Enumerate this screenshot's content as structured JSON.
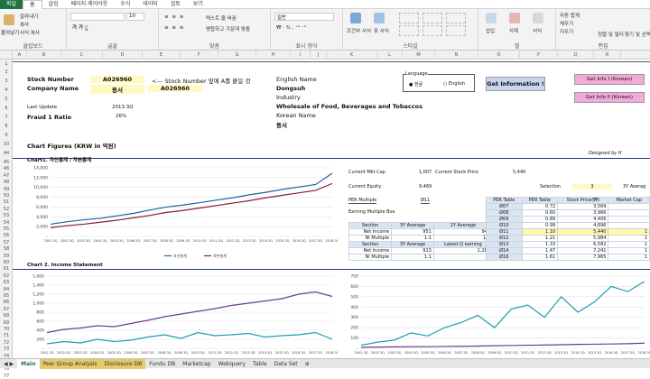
{
  "ribbon_tabs": [
    "파일",
    "홈",
    "삽입",
    "페이지 레이아웃",
    "수식",
    "데이터",
    "검토",
    "보기"
  ],
  "ribbon": {
    "clipboard": {
      "label": "클립보드",
      "paste": "붙여넣기",
      "cut": "잘라내기",
      "copy": "복사",
      "format": "서식 복사"
    },
    "font": {
      "label": "글꼴",
      "size": "10"
    },
    "align": {
      "label": "맞춤",
      "wrap": "텍스트 줄 바꿈",
      "merge": "병합하고 가운데 맞춤"
    },
    "number": {
      "label": "표시 형식",
      "fmt": "일반"
    },
    "styles": {
      "label": "스타일",
      "cond": "조건부 서식",
      "table": "표 서식"
    },
    "cells": {
      "label": "셀",
      "insert": "삽입",
      "delete": "삭제",
      "format": "서식"
    },
    "edit": {
      "label": "편집",
      "autosum": "자동 합계",
      "fill": "채우기",
      "clear": "지우기",
      "sort": "정렬 및 필터",
      "find": "찾기 및 선택"
    }
  },
  "columns": [
    "A",
    "B",
    "C",
    "D",
    "E",
    "F",
    "G",
    "H",
    "I",
    "J",
    "K",
    "L",
    "M",
    "N",
    "O",
    "P",
    "Q",
    "R"
  ],
  "rows": [
    "1",
    "2",
    "3",
    "4",
    "5",
    "6",
    "7",
    "8",
    "9",
    "10",
    "44",
    "45",
    "46",
    "47",
    "48",
    "49",
    "50",
    "51",
    "52",
    "53",
    "54",
    "55",
    "56",
    "57",
    "58",
    "59",
    "60",
    "61",
    "62",
    "63",
    "64",
    "65",
    "66",
    "67",
    "68",
    "69",
    "70",
    "71",
    "72",
    "73",
    "74",
    "75",
    "76",
    "77"
  ],
  "sheet": {
    "stock_number_label": "Stock Number",
    "stock_number": "A026960",
    "hint": "<--- Stock Number 앞에 A를 붙일 것",
    "company_name_label": "Company Name",
    "company_name": "동서",
    "company_code": "A026960",
    "english_name_label": "English Name",
    "english_name": "Dongsuh",
    "industry_label": "Industry",
    "industry": "Wholesale of Food, Beverages and Tobaccos",
    "korean_name_label": "Korean Name",
    "korean_name": "동서",
    "last_update_label": "Last Update",
    "last_update": "2013.3Q",
    "fraud_label": "Fraud 1 Ratio",
    "fraud": "26%",
    "language_label": "Language",
    "lang_kr": "한글",
    "lang_en": "English",
    "get_info": "Get Information !",
    "get_info1": "Get Info I (Korean)",
    "get_info2": "Get Info II (Korean)",
    "chart_figures": "Chart Figures (KRW in 억원)",
    "designed_by": "Designed by H",
    "chart1_title": "Chart1. 자산총계 / 자본총계",
    "chart2_title": "Chart 2. Income Statement",
    "cur_mkt_cap_label": "Current Mkt Cap",
    "cur_mkt_cap": "1,007",
    "cur_price_label": "Current Stock Price",
    "cur_price": "5,440",
    "cur_equity_label": "Current Equity",
    "cur_equity": "9,469",
    "per_mult_label": "PER Multiple",
    "per_mult": "Ø11",
    "emb_label": "Earning Multiple Box",
    "selection_label": "Selection",
    "selection": "3",
    "avg_label": "3Y Averag"
  },
  "emb": {
    "head1": [
      "Section",
      "3Y Average",
      "2Y Average"
    ],
    "r1": [
      "Net Income",
      "951",
      "941"
    ],
    "r2": [
      "NI Multiple",
      "1.1",
      "1.1"
    ],
    "head2": [
      "Section",
      "3Y Average",
      "Latest Q earning"
    ],
    "r3": [
      "Net Income",
      "913",
      "1,282"
    ],
    "r4": [
      "NI Multiple",
      "1.1",
      "8"
    ]
  },
  "per_table": {
    "head": [
      "PER Table",
      "PER Table",
      "Stock Price(₩)",
      "Market Cap"
    ],
    "rows": [
      [
        "Ø07",
        "0.72",
        "3,569",
        ""
      ],
      [
        "Ø08",
        "0.60",
        "3,966",
        ""
      ],
      [
        "Ø09",
        "0.89",
        "4,406",
        ""
      ],
      [
        "Ø10",
        "0.99",
        "4,896",
        ""
      ],
      [
        "Ø11",
        "1.10",
        "5,440",
        "1"
      ],
      [
        "Ø12",
        "1.21",
        "5,984",
        "1"
      ],
      [
        "Ø13",
        "1.33",
        "6,582",
        "1"
      ],
      [
        "Ø14",
        "1.47",
        "7,241",
        "1"
      ],
      [
        "Ø16",
        "1.61",
        "7,965",
        "1"
      ]
    ]
  },
  "chart_data": [
    {
      "type": "line",
      "title": "Chart1. 자산총계 / 자본총계",
      "ylim": [
        0,
        14000
      ],
      "yticks": [
        "-",
        "2,000",
        "4,000",
        "6,000",
        "8,000",
        "10,000",
        "12,000",
        "14,000"
      ],
      "categories": [
        "2001.3Q",
        "2002.3Q",
        "2003.3Q",
        "2004.3Q",
        "2005.3Q",
        "2006.3Q",
        "2007.3Q",
        "2008.3Q",
        "2009.3Q",
        "2010.3Q",
        "2011.3Q",
        "2012.3Q",
        "2013.3Q",
        "2014.3Q",
        "2015.3Q",
        "2016.3Q",
        "2017.3Q",
        "2018.3Q"
      ],
      "legend": [
        "자산총계",
        "자본총계"
      ],
      "colors": [
        "#1f5fa8",
        "#8b1a3a"
      ],
      "series": [
        {
          "name": "자산총계",
          "values": [
            2500,
            3000,
            3400,
            3700,
            4200,
            4700,
            5400,
            6000,
            6400,
            6900,
            7400,
            7900,
            8500,
            9000,
            9600,
            10100,
            10600,
            12900
          ]
        },
        {
          "name": "자본총계",
          "values": [
            1800,
            2200,
            2500,
            2900,
            3300,
            3800,
            4300,
            4900,
            5300,
            5800,
            6300,
            6800,
            7300,
            7900,
            8400,
            8900,
            9400,
            10800
          ]
        }
      ]
    },
    {
      "type": "line",
      "title": "Chart 2. Income Statement",
      "ylim": [
        0,
        1600
      ],
      "yticks": [
        "-",
        "200",
        "400",
        "600",
        "800",
        "1,000",
        "1,200",
        "1,400",
        "1,600"
      ],
      "categories": [
        "2001.3Q",
        "2002.3Q",
        "2003.3Q",
        "2004.3Q",
        "2005.3Q",
        "2006.3Q",
        "2007.3Q",
        "2008.3Q",
        "2009.3Q",
        "2010.3Q",
        "2011.3Q",
        "2012.3Q",
        "2013.3Q",
        "2014.3Q",
        "2015.3Q",
        "2016.3Q",
        "2017.3Q",
        "2018.3Q"
      ],
      "colors": [
        "#6a3d8e",
        "#1f9bb0"
      ],
      "series": [
        {
          "values": [
            350,
            420,
            450,
            500,
            480,
            550,
            620,
            700,
            760,
            820,
            880,
            950,
            1000,
            1050,
            1100,
            1200,
            1250,
            1150
          ]
        },
        {
          "values": [
            100,
            150,
            120,
            200,
            150,
            180,
            250,
            300,
            220,
            350,
            280,
            300,
            330,
            250,
            280,
            300,
            350,
            200
          ]
        }
      ]
    },
    {
      "type": "line",
      "ylim": [
        0,
        700
      ],
      "yticks": [
        "-",
        "100",
        "200",
        "300",
        "400",
        "500",
        "600",
        "700"
      ],
      "categories": [
        "2001.3Q",
        "2002.3Q",
        "2003.3Q",
        "2004.3Q",
        "2005.3Q",
        "2006.3Q",
        "2007.3Q",
        "2008.3Q",
        "2009.3Q",
        "2010.3Q",
        "2011.3Q",
        "2012.3Q",
        "2013.3Q",
        "2014.3Q",
        "2015.3Q",
        "2016.3Q",
        "2017.3Q",
        "2018.3Q"
      ],
      "colors": [
        "#1f9bb0",
        "#6a3d8e"
      ],
      "series": [
        {
          "values": [
            30,
            60,
            80,
            150,
            120,
            200,
            250,
            320,
            200,
            380,
            420,
            300,
            500,
            350,
            450,
            600,
            550,
            650
          ]
        },
        {
          "values": [
            10,
            12,
            14,
            15,
            16,
            18,
            20,
            22,
            25,
            28,
            30,
            32,
            35,
            38,
            40,
            42,
            45,
            50
          ]
        }
      ]
    }
  ],
  "sheet_tabs": [
    "Main",
    "Peer Group Analysis",
    "Disclosure DB",
    "Fundu DB",
    "Marketcap",
    "Webquery",
    "Table",
    "Data Set",
    "⊕"
  ]
}
